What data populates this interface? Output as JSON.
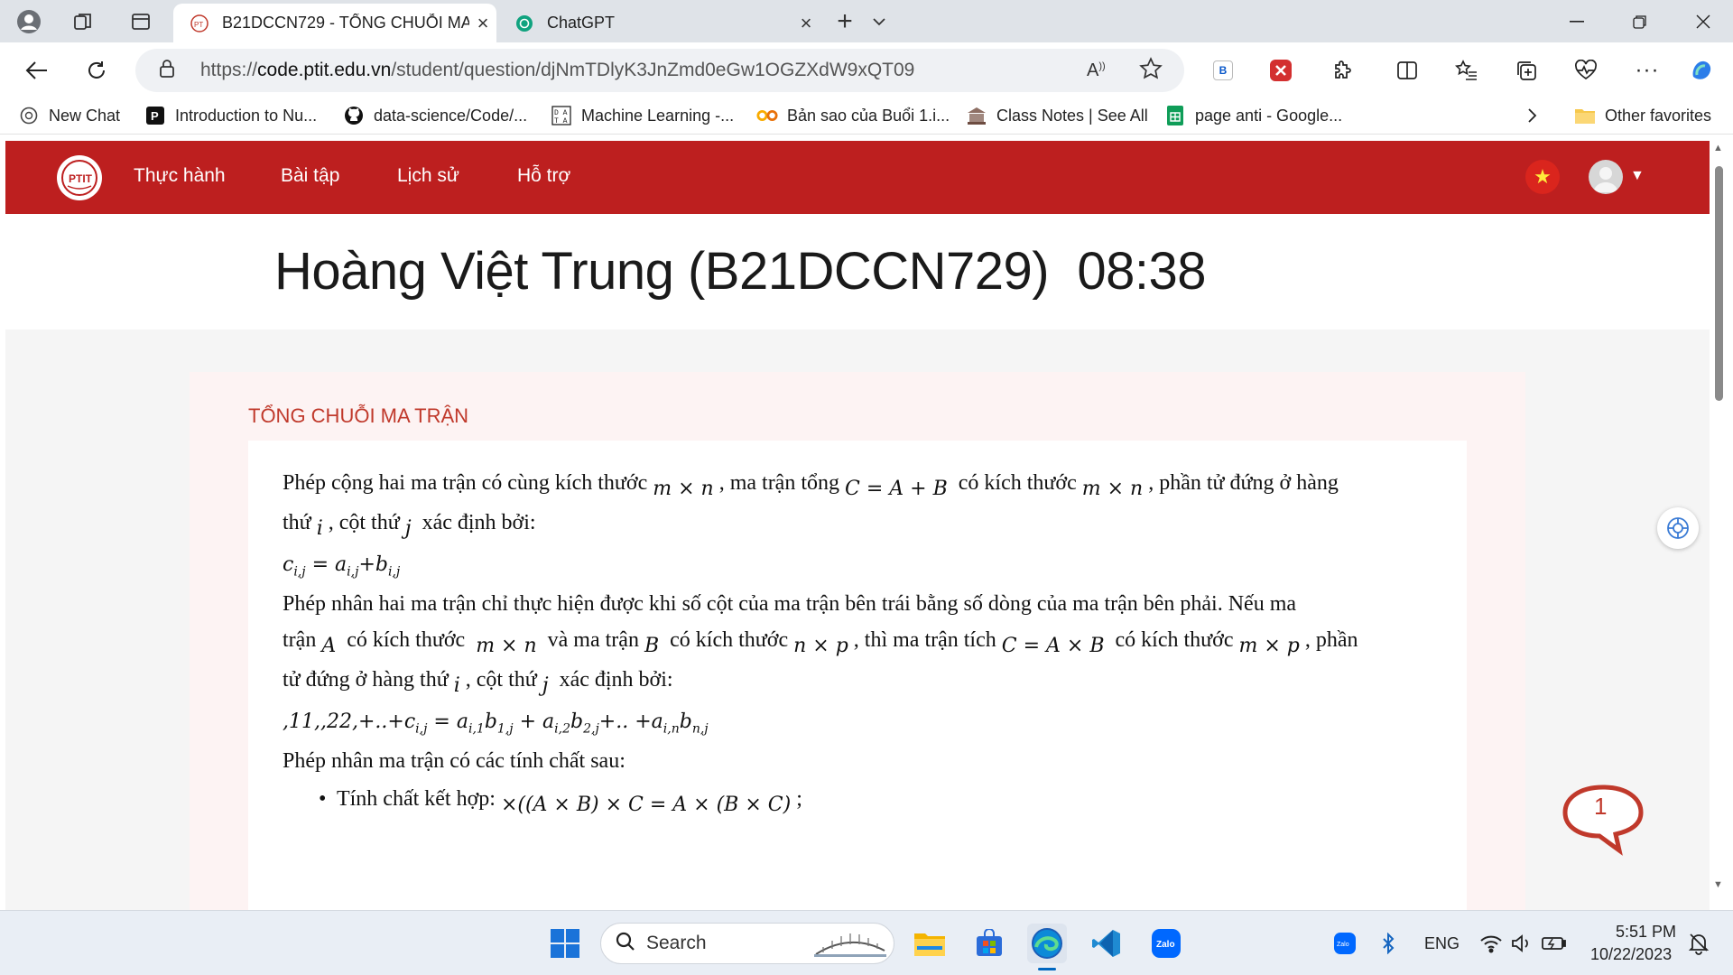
{
  "browser": {
    "tabs": [
      {
        "title": "B21DCCN729 - TỔNG CHUỖI MA TRẬN",
        "active": true
      },
      {
        "title": "ChatGPT",
        "active": false
      }
    ],
    "url_prefix": "https://",
    "url_host": "code.ptit.edu.vn",
    "url_path": "/student/question/djNmTDlyK3JnZmd0eGw1OGZXdW9xQT09",
    "favorites": [
      {
        "label": "New Chat",
        "icon": "chatgpt-icon"
      },
      {
        "label": "Introduction to Nu...",
        "icon": "p-icon"
      },
      {
        "label": "data-science/Code/...",
        "icon": "github-icon"
      },
      {
        "label": "Machine Learning -...",
        "icon": "data-icon"
      },
      {
        "label": "Bản sao của Buổi 1.i...",
        "icon": "colab-icon"
      },
      {
        "label": "Class Notes | See All",
        "icon": "classnotes-icon"
      },
      {
        "label": "page anti - Google...",
        "icon": "sheets-icon"
      }
    ],
    "other_favorites": "Other favorites"
  },
  "site": {
    "nav": [
      "Thực hành",
      "Bài tập",
      "Lịch sử",
      "Hỗ trợ"
    ],
    "student_header": "Hoàng Việt Trung (B21DCCN729)  08:38",
    "question_title": "TỔNG CHUỖI MA TRẬN",
    "chat_count": "1"
  },
  "taskbar": {
    "search_label": "Search",
    "language": "ENG",
    "time": "5:51 PM",
    "date": "10/22/2023"
  },
  "colors": {
    "brand_red": "#bd1f1f",
    "title_red": "#c0392b",
    "accent_blue": "#0067c0"
  }
}
